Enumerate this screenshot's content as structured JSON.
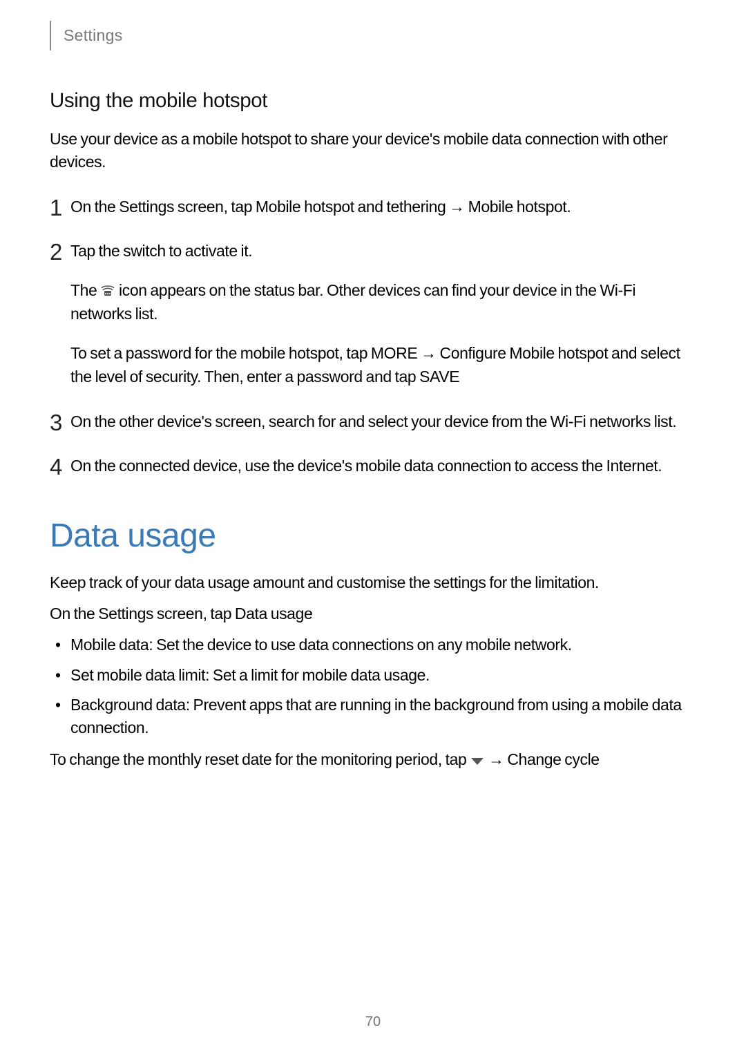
{
  "header": {
    "section_label": "Settings"
  },
  "hotspot": {
    "subheading": "Using the mobile hotspot",
    "intro": "Use your device as a mobile hotspot to share your device's mobile data connection with other devices.",
    "steps": {
      "s1_pre": "On the Settings screen, tap ",
      "s1_em1": "Mobile hotspot and tethering",
      "s1_mid": " → ",
      "s1_em2": "Mobile hotspot",
      "s1_post": ".",
      "s2_line1": "Tap the switch to activate it.",
      "s2_line2_pre": "The ",
      "s2_line2_post": " icon appears on the status bar. Other devices can find your device in the Wi-Fi networks list.",
      "s2_line3_pre": "To set a password for the mobile hotspot, tap ",
      "s2_line3_em1": "MORE",
      "s2_line3_mid1": " → ",
      "s2_line3_em2": "Configure Mobile hotspot",
      "s2_line3_mid2": " and select the level of security. Then, enter a password and tap ",
      "s2_line3_em3": "SAVE",
      "s3": "On the other device's screen, search for and select your device from the Wi-Fi networks list.",
      "s4": "On the connected device, use the device's mobile data connection to access the Internet."
    }
  },
  "datausage": {
    "title": "Data usage",
    "intro1": "Keep track of your data usage amount and customise the settings for the limitation.",
    "intro2_pre": "On the Settings screen, tap ",
    "intro2_em": "Data usage",
    "bullets": {
      "b1_em": "Mobile data",
      "b1_rest": ": Set the device to use data connections on any mobile network.",
      "b2_em": "Set mobile data limit",
      "b2_rest": ": Set a limit for mobile data usage.",
      "b3_em": "Background data",
      "b3_rest": ": Prevent apps that are running in the background from using a mobile data connection."
    },
    "closing_pre": "To change the monthly reset date for the monitoring period, tap ",
    "closing_mid": " → ",
    "closing_em": "Change cycle"
  },
  "page_number": "70",
  "icons": {
    "hotspot_glyph": "hotspot-icon",
    "dropdown_glyph": "dropdown-icon"
  }
}
